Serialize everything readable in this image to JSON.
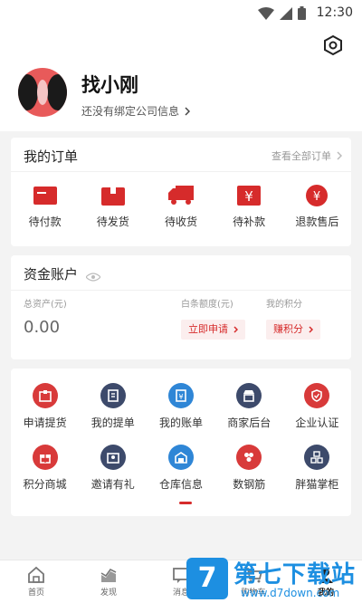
{
  "status_bar": {
    "time": "12:30",
    "icons": [
      "wifi-icon",
      "signal-icon",
      "battery-icon"
    ]
  },
  "profile": {
    "name": "找小刚",
    "company_link": "还没有绑定公司信息",
    "settings_icon": "gear-icon"
  },
  "orders": {
    "title": "我的订单",
    "view_all": "查看全部订单",
    "items": [
      {
        "label": "待付款",
        "icon": "wallet-icon"
      },
      {
        "label": "待发货",
        "icon": "box-icon"
      },
      {
        "label": "待收货",
        "icon": "truck-icon"
      },
      {
        "label": "待补款",
        "icon": "yen-card-icon"
      },
      {
        "label": "退款售后",
        "icon": "refund-icon"
      }
    ]
  },
  "funds": {
    "title": "资金账户",
    "total_assets_label": "总资产(元)",
    "total_assets_value": "0.00",
    "credit_label": "白条额度(元)",
    "credit_button": "立即申请",
    "points_label": "我的积分",
    "points_button": "赚积分"
  },
  "services": [
    {
      "label": "申请提货",
      "icon": "pickup-icon",
      "color": "#d83a3a"
    },
    {
      "label": "我的提单",
      "icon": "bill-icon",
      "color": "#3d4a6b"
    },
    {
      "label": "我的账单",
      "icon": "ledger-icon",
      "color": "#2f86d6"
    },
    {
      "label": "商家后台",
      "icon": "store-icon",
      "color": "#3d4a6b"
    },
    {
      "label": "企业认证",
      "icon": "shield-check-icon",
      "color": "#d83a3a"
    },
    {
      "label": "积分商城",
      "icon": "gift-icon",
      "color": "#d83a3a"
    },
    {
      "label": "邀请有礼",
      "icon": "invite-icon",
      "color": "#3d4a6b"
    },
    {
      "label": "仓库信息",
      "icon": "warehouse-icon",
      "color": "#2f86d6"
    },
    {
      "label": "数钢筋",
      "icon": "rebar-icon",
      "color": "#d83a3a"
    },
    {
      "label": "胖猫掌柜",
      "icon": "grid-icon",
      "color": "#3d4a6b"
    }
  ],
  "tabs": [
    {
      "label": "首页",
      "icon": "home-icon"
    },
    {
      "label": "发现",
      "icon": "chart-icon"
    },
    {
      "label": "消息",
      "icon": "message-icon"
    },
    {
      "label": "购物车",
      "icon": "cart-icon"
    },
    {
      "label": "我的",
      "icon": "user-icon"
    }
  ],
  "watermark": {
    "logo_char": "7",
    "text": "第七下载站",
    "url": "www.d7down.com"
  },
  "colors": {
    "accent": "#d62b2b",
    "blue": "#2f86d6",
    "navy": "#3d4a6b"
  }
}
